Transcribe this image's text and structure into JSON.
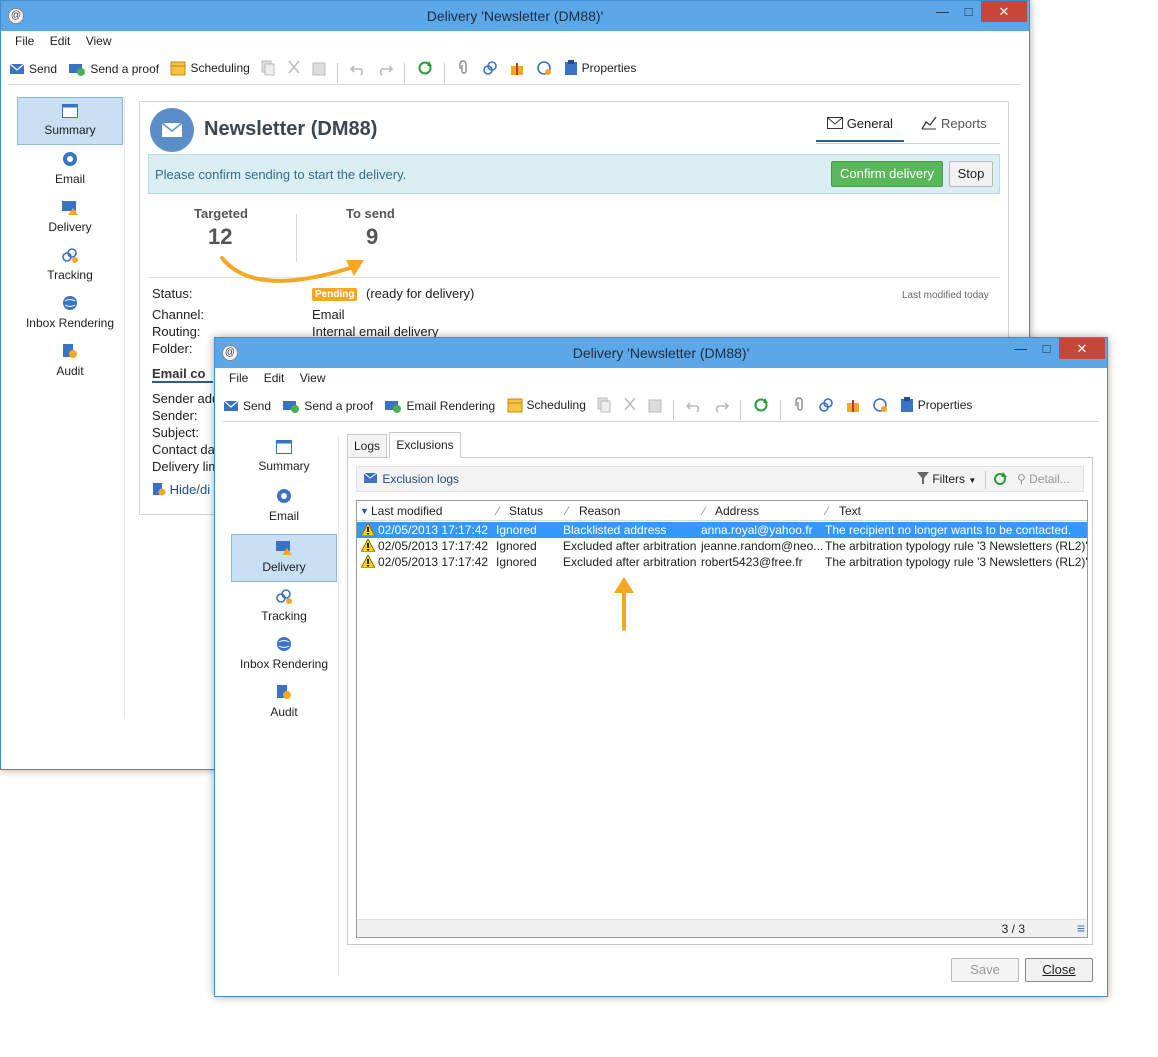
{
  "back_window": {
    "title": "Delivery 'Newsletter (DM88)'",
    "menu": [
      "File",
      "Edit",
      "View"
    ],
    "toolbar": {
      "send": "Send",
      "send_proof": "Send a proof",
      "scheduling": "Scheduling",
      "properties": "Properties"
    },
    "nav": [
      {
        "label": "Summary",
        "icon": "summary-icon"
      },
      {
        "label": "Email",
        "icon": "email-icon"
      },
      {
        "label": "Delivery",
        "icon": "delivery-icon"
      },
      {
        "label": "Tracking",
        "icon": "tracking-icon"
      },
      {
        "label": "Inbox Rendering",
        "icon": "inbox-rendering-icon"
      },
      {
        "label": "Audit",
        "icon": "audit-icon"
      }
    ],
    "header": {
      "title": "Newsletter (DM88)",
      "tab_general": "General",
      "tab_reports": "Reports"
    },
    "alert": {
      "message": "Please confirm sending to start the delivery.",
      "confirm_label": "Confirm delivery",
      "stop_label": "Stop"
    },
    "stats": {
      "targeted_label": "Targeted",
      "targeted_value": "12",
      "to_send_label": "To send",
      "to_send_value": "9"
    },
    "details": {
      "status_label": "Status:",
      "status_badge": "Pending",
      "status_text": "(ready for delivery)",
      "last_modified": "Last modified today",
      "channel_label": "Channel:",
      "channel_value": "Email",
      "routing_label": "Routing:",
      "routing_value": "Internal email delivery",
      "folder_label": "Folder:"
    },
    "email_section": {
      "heading": "Email co",
      "sender_address": "Sender add",
      "sender": "Sender:",
      "subject": "Subject:",
      "contact_date": "Contact da",
      "delivery_limit": "Delivery lim",
      "hide_link": "Hide/di"
    }
  },
  "front_window": {
    "title": "Delivery 'Newsletter (DM88)'",
    "menu": [
      "File",
      "Edit",
      "View"
    ],
    "toolbar": {
      "send": "Send",
      "send_proof": "Send a proof",
      "email_rendering": "Email Rendering",
      "scheduling": "Scheduling",
      "properties": "Properties"
    },
    "nav": [
      {
        "label": "Summary"
      },
      {
        "label": "Email"
      },
      {
        "label": "Delivery"
      },
      {
        "label": "Tracking"
      },
      {
        "label": "Inbox Rendering"
      },
      {
        "label": "Audit"
      }
    ],
    "tabs": {
      "logs": "Logs",
      "exclusions": "Exclusions"
    },
    "exclusion_toolbar": {
      "exclusion_logs": "Exclusion logs",
      "filters": "Filters",
      "detail": "Detail..."
    },
    "table": {
      "columns": [
        "Last modified",
        "Status",
        "Reason",
        "Address",
        "Text"
      ],
      "rows": [
        {
          "date": "02/05/2013 17:17:42",
          "status": "Ignored",
          "reason": "Blacklisted address",
          "address": "anna.royal@yahoo.fr",
          "text": "The recipient no longer wants to be contacted."
        },
        {
          "date": "02/05/2013 17:17:42",
          "status": "Ignored",
          "reason": "Excluded after arbitration",
          "address": "jeanne.random@neo...",
          "text": "The arbitration typology rule '3 Newsletters (RL2)'"
        },
        {
          "date": "02/05/2013 17:17:42",
          "status": "Ignored",
          "reason": "Excluded after arbitration",
          "address": "robert5423@free.fr",
          "text": "The arbitration typology rule '3 Newsletters (RL2)'"
        }
      ],
      "count": "3 / 3"
    },
    "footer": {
      "save": "Save",
      "close": "Close"
    }
  },
  "colors": {
    "titlebar": "#5ba7e7",
    "accent_orange": "#f5a623",
    "confirm_green": "#5bb75b",
    "selection_blue": "#3399ff",
    "alert_bg": "#daeef3"
  }
}
